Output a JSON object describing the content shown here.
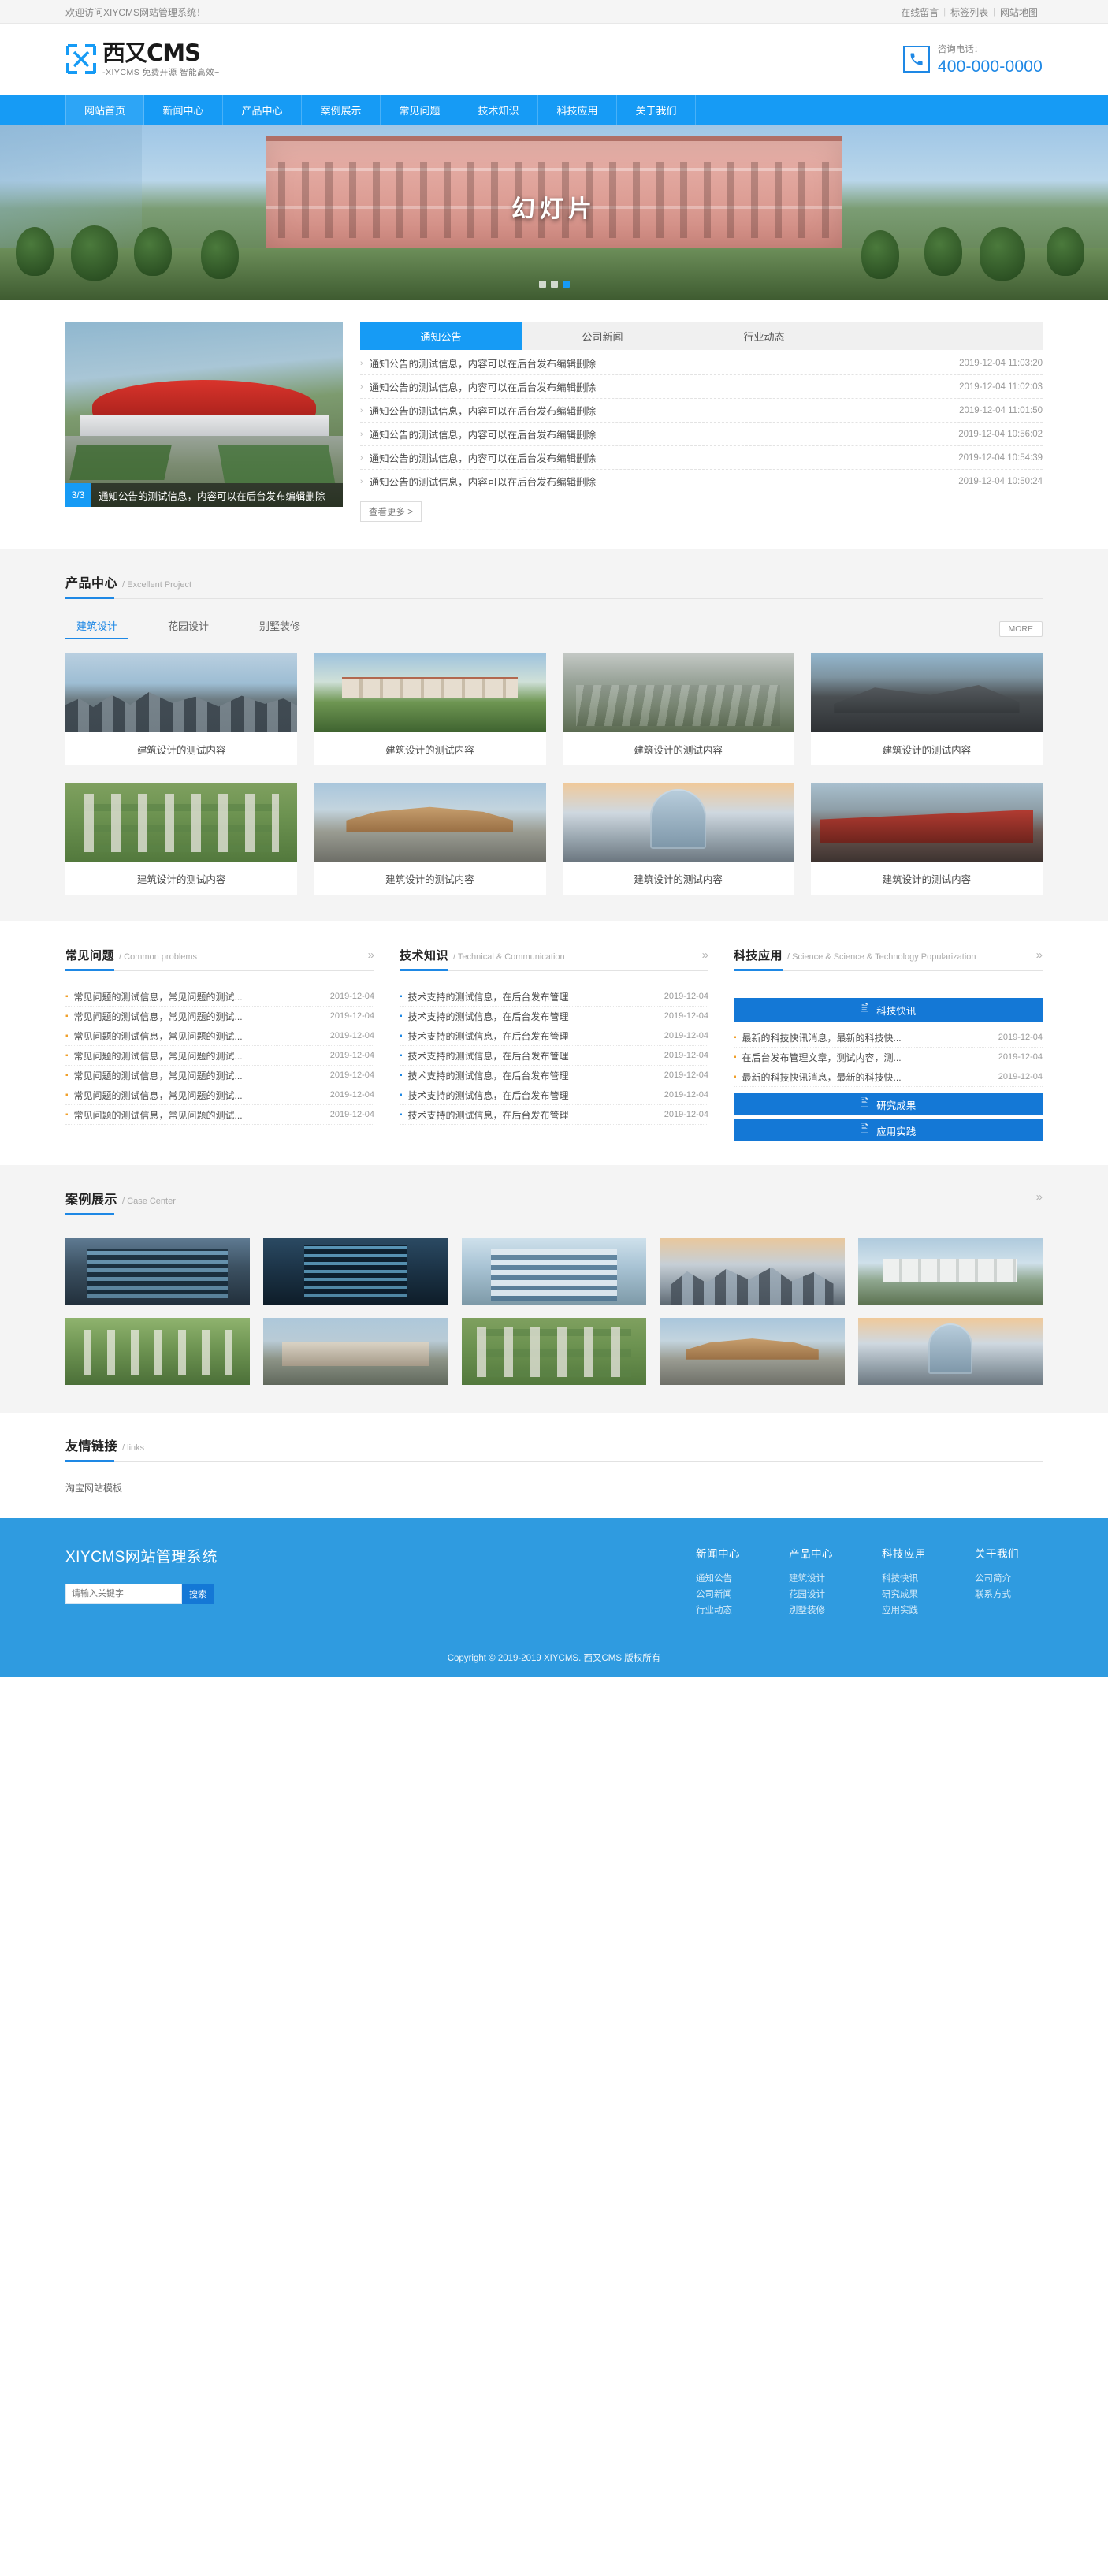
{
  "topbar": {
    "welcome": "欢迎访问XIYCMS网站管理系统！",
    "links": [
      "在线留言",
      "标签列表",
      "网站地图"
    ],
    "separator": "|"
  },
  "header": {
    "logo_cn": "西又CMS",
    "logo_sub": "-XIYCMS 免费开源 智能高效~",
    "phone_label": "咨询电话：",
    "phone_number": "400-000-0000",
    "phone_icon": "phone-icon"
  },
  "nav": {
    "items": [
      {
        "label": "网站首页",
        "active": true
      },
      {
        "label": "新闻中心",
        "active": false
      },
      {
        "label": "产品中心",
        "active": false
      },
      {
        "label": "案例展示",
        "active": false
      },
      {
        "label": "常见问题",
        "active": false
      },
      {
        "label": "技术知识",
        "active": false
      },
      {
        "label": "科技应用",
        "active": false
      },
      {
        "label": "关于我们",
        "active": false
      }
    ]
  },
  "banner": {
    "title": "幻灯片",
    "dots": 3,
    "active_dot": 2
  },
  "news": {
    "feature": {
      "index": "3/3",
      "caption": "通知公告的测试信息，内容可以在后台发布编辑删除"
    },
    "tabs": [
      {
        "label": "通知公告",
        "active": true
      },
      {
        "label": "公司新闻",
        "active": false
      },
      {
        "label": "行业动态",
        "active": false
      }
    ],
    "items": [
      {
        "title": "通知公告的测试信息，内容可以在后台发布编辑删除",
        "date": "2019-12-04 11:03:20"
      },
      {
        "title": "通知公告的测试信息，内容可以在后台发布编辑删除",
        "date": "2019-12-04 11:02:03"
      },
      {
        "title": "通知公告的测试信息，内容可以在后台发布编辑删除",
        "date": "2019-12-04 11:01:50"
      },
      {
        "title": "通知公告的测试信息，内容可以在后台发布编辑删除",
        "date": "2019-12-04 10:56:02"
      },
      {
        "title": "通知公告的测试信息，内容可以在后台发布编辑删除",
        "date": "2019-12-04 10:54:39"
      },
      {
        "title": "通知公告的测试信息，内容可以在后台发布编辑删除",
        "date": "2019-12-04 10:50:24"
      }
    ],
    "more_label": "查看更多 >"
  },
  "products": {
    "title_cn": "产品中心",
    "title_en": "/ Excellent Project",
    "tabs": [
      {
        "label": "建筑设计",
        "active": true
      },
      {
        "label": "花园设计",
        "active": false
      },
      {
        "label": "别墅装修",
        "active": false
      }
    ],
    "more_label": "MORE",
    "items": [
      {
        "caption": "建筑设计的测试内容",
        "scene": "sc-city"
      },
      {
        "caption": "建筑设计的测试内容",
        "scene": "sc-campus"
      },
      {
        "caption": "建筑设计的测试内容",
        "scene": "sc-plaza"
      },
      {
        "caption": "建筑设计的测试内容",
        "scene": "sc-dark"
      },
      {
        "caption": "建筑设计的测试内容",
        "scene": "sc-aerial"
      },
      {
        "caption": "建筑设计的测试内容",
        "scene": "sc-street"
      },
      {
        "caption": "建筑设计的测试内容",
        "scene": "sc-tower"
      },
      {
        "caption": "建筑设计的测试内容",
        "scene": "sc-red"
      }
    ]
  },
  "faq": {
    "title_cn": "常见问题",
    "title_en": "/ Common problems",
    "items": [
      {
        "title": "常见问题的测试信息，常见问题的测试...",
        "date": "2019-12-04"
      },
      {
        "title": "常见问题的测试信息，常见问题的测试...",
        "date": "2019-12-04"
      },
      {
        "title": "常见问题的测试信息，常见问题的测试...",
        "date": "2019-12-04"
      },
      {
        "title": "常见问题的测试信息，常见问题的测试...",
        "date": "2019-12-04"
      },
      {
        "title": "常见问题的测试信息，常见问题的测试...",
        "date": "2019-12-04"
      },
      {
        "title": "常见问题的测试信息，常见问题的测试...",
        "date": "2019-12-04"
      },
      {
        "title": "常见问题的测试信息，常见问题的测试...",
        "date": "2019-12-04"
      }
    ]
  },
  "tech": {
    "title_cn": "技术知识",
    "title_en": "/ Technical & Communication",
    "items": [
      {
        "title": "技术支持的测试信息，在后台发布管理",
        "date": "2019-12-04"
      },
      {
        "title": "技术支持的测试信息，在后台发布管理",
        "date": "2019-12-04"
      },
      {
        "title": "技术支持的测试信息，在后台发布管理",
        "date": "2019-12-04"
      },
      {
        "title": "技术支持的测试信息，在后台发布管理",
        "date": "2019-12-04"
      },
      {
        "title": "技术支持的测试信息，在后台发布管理",
        "date": "2019-12-04"
      },
      {
        "title": "技术支持的测试信息，在后台发布管理",
        "date": "2019-12-04"
      },
      {
        "title": "技术支持的测试信息，在后台发布管理",
        "date": "2019-12-04"
      }
    ]
  },
  "sci": {
    "title_cn": "科技应用",
    "title_en": "/ Science & Science & Technology Popularization",
    "button_top": "科技快讯",
    "items": [
      {
        "title": "最新的科技快讯消息，最新的科技快...",
        "date": "2019-12-04"
      },
      {
        "title": "在后台发布管理文章，测试内容，测...",
        "date": "2019-12-04"
      },
      {
        "title": "最新的科技快讯消息，最新的科技快...",
        "date": "2019-12-04"
      }
    ],
    "button_mid": "研究成果",
    "button_bottom": "应用实践"
  },
  "cases": {
    "title_cn": "案例展示",
    "title_en": "/ Case Center",
    "items": [
      {
        "scene": "sc-glass"
      },
      {
        "scene": "sc-blue"
      },
      {
        "scene": "sc-office"
      },
      {
        "scene": "sc-sky"
      },
      {
        "scene": "sc-white"
      },
      {
        "scene": "sc-greenroof"
      },
      {
        "scene": "sc-lowrise"
      },
      {
        "scene": "sc-aerial"
      },
      {
        "scene": "sc-street"
      },
      {
        "scene": "sc-tower"
      }
    ]
  },
  "links": {
    "title_cn": "友情链接",
    "title_en": "/ links",
    "items": [
      "淘宝网站模板"
    ]
  },
  "footer": {
    "brand": "XIYCMS网站管理系统",
    "search_placeholder": "请输入关键字",
    "search_value": "",
    "search_button": "搜索",
    "columns": [
      {
        "title": "新闻中心",
        "items": [
          "通知公告",
          "公司新闻",
          "行业动态"
        ]
      },
      {
        "title": "产品中心",
        "items": [
          "建筑设计",
          "花园设计",
          "别墅装修"
        ]
      },
      {
        "title": "科技应用",
        "items": [
          "科技快讯",
          "研究成果",
          "应用实践"
        ]
      },
      {
        "title": "关于我们",
        "items": [
          "公司简介",
          "联系方式"
        ]
      }
    ],
    "copyright": "Copyright © 2019-2019 XIYCMS. 西又CMS 版权所有"
  },
  "colors": {
    "primary": "#169bf5",
    "accent": "#1e88e5",
    "footer_bg": "#2f9be0",
    "button_blue": "#1478d6"
  }
}
